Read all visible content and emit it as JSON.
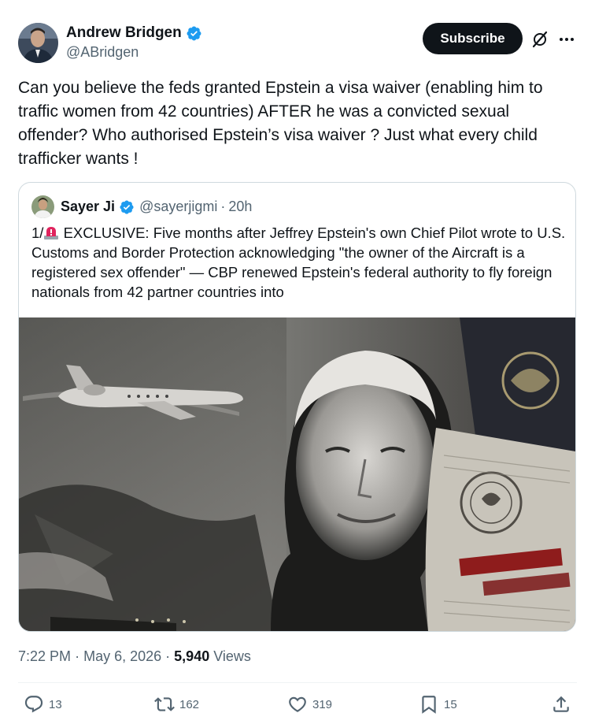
{
  "author": {
    "name": "Andrew Bridgen",
    "handle": "@ABridgen",
    "verified": true
  },
  "header": {
    "subscribe_label": "Subscribe",
    "icons": [
      "grok-icon",
      "more-icon"
    ]
  },
  "tweet": {
    "text": "Can you believe the feds granted Epstein a visa waiver (enabling him to traffic women from 42 countries) AFTER he was a convicted sexual offender? Who authorised Epstein’s visa waiver ? Just what every child trafficker wants !"
  },
  "quote": {
    "name": "Sayer Ji",
    "handle": "@sayerjigmi",
    "separator": "·",
    "time": "20h",
    "text_prefix": "1/",
    "text": " EXCLUSIVE: Five months after Jeffrey Epstein's own Chief Pilot wrote to U.S. Customs and Border Protection acknowledging \"the owner of the Aircraft is a registered sex offender\" — CBP renewed Epstein's federal authority to fly foreign nationals from 42 partner countries into"
  },
  "meta": {
    "time": "7:22 PM",
    "dot1": "·",
    "date": "May 6, 2026",
    "dot2": "·",
    "views_count": "5,940",
    "views_label": "Views"
  },
  "actions": {
    "replies": "13",
    "reposts": "162",
    "likes": "319",
    "bookmarks": "15"
  },
  "colors": {
    "text": "#0f1419",
    "secondary": "#536471",
    "verified": "#1d9bf0",
    "border": "#cfd9de",
    "siren": "#e0245e"
  }
}
